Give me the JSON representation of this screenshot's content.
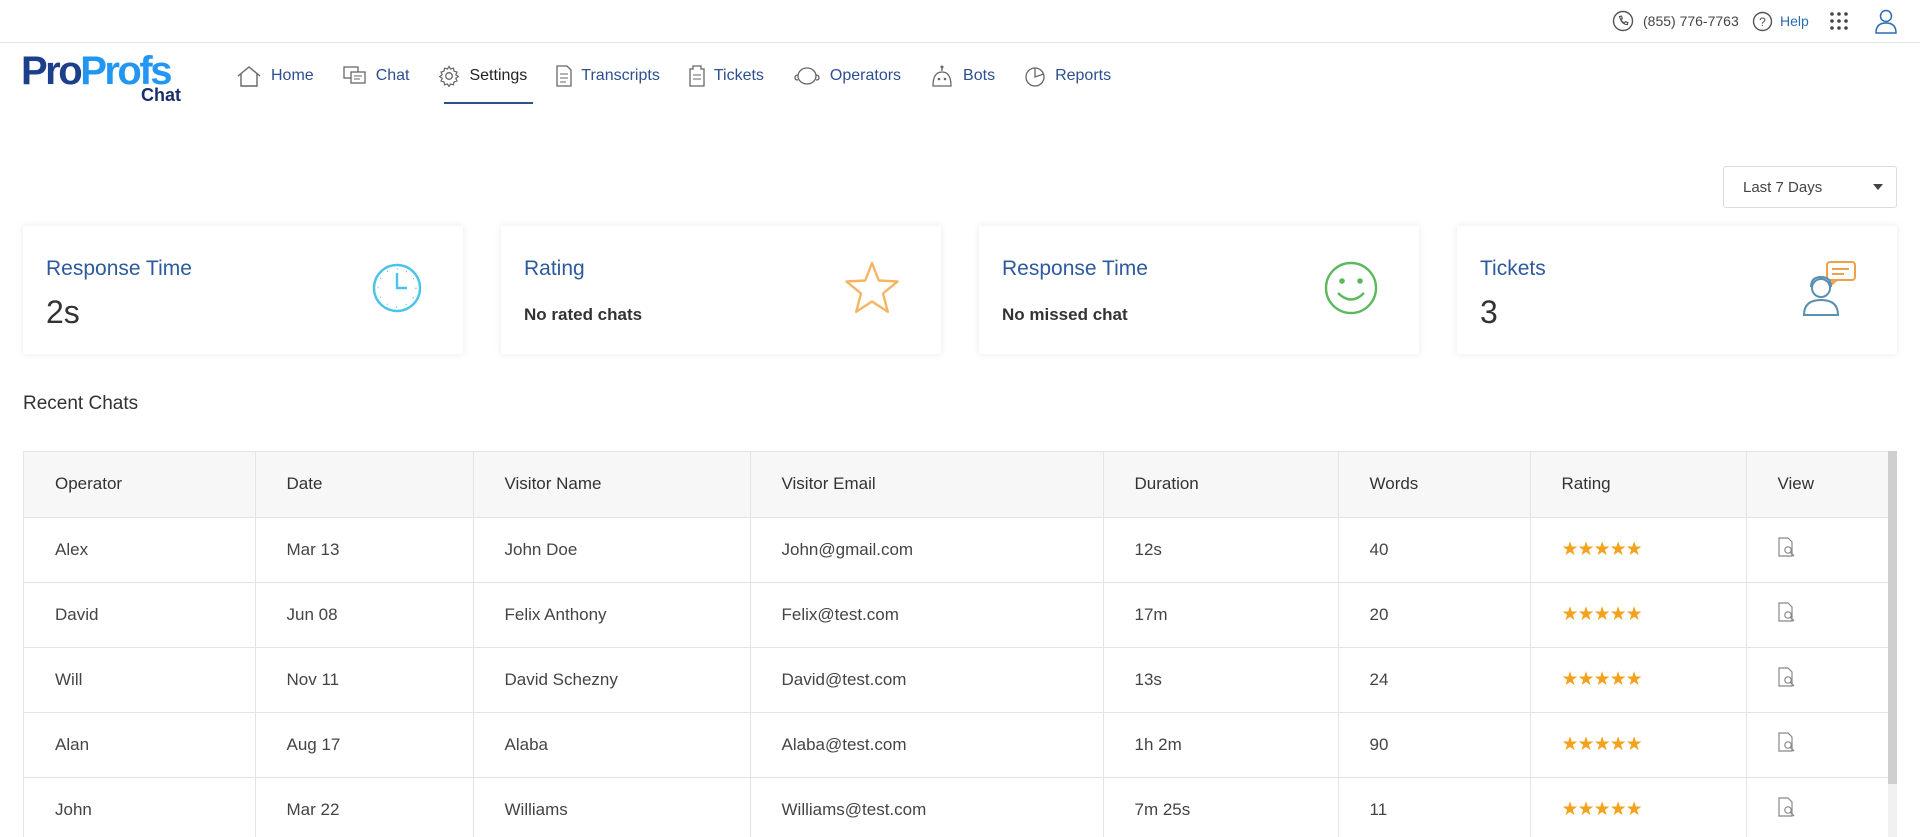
{
  "topbar": {
    "phone": "(855) 776-7763",
    "help": "Help",
    "icons": {
      "phone": "phone-icon",
      "help": "help-circle-icon",
      "apps": "apps-grid-icon",
      "user": "user-icon"
    }
  },
  "logo": {
    "pro": "Pro",
    "profs": "Profs",
    "product": "Chat"
  },
  "nav": [
    {
      "label": "Home",
      "icon": "home-icon"
    },
    {
      "label": "Chat",
      "icon": "chat-icon"
    },
    {
      "label": "Settings",
      "icon": "gear-icon",
      "active": true
    },
    {
      "label": "Transcripts",
      "icon": "document-icon"
    },
    {
      "label": "Tickets",
      "icon": "ticket-icon"
    },
    {
      "label": "Operators",
      "icon": "operators-icon"
    },
    {
      "label": "Bots",
      "icon": "bot-icon"
    },
    {
      "label": "Reports",
      "icon": "pie-chart-icon"
    }
  ],
  "filter": {
    "selected": "Last 7 Days"
  },
  "cards": [
    {
      "title": "Response Time",
      "value": "2s",
      "icon": "clock-icon"
    },
    {
      "title": "Rating",
      "subtitle": "No rated chats",
      "icon": "star-icon"
    },
    {
      "title": "Response Time",
      "subtitle": "No missed chat",
      "icon": "smiley-icon"
    },
    {
      "title": "Tickets",
      "value": "3",
      "icon": "support-agent-icon"
    }
  ],
  "recent": {
    "title": "Recent Chats",
    "columns": [
      "Operator",
      "Date",
      "Visitor Name",
      "Visitor Email",
      "Duration",
      "Words",
      "Rating",
      "View"
    ],
    "rows": [
      {
        "operator": "Alex",
        "date": "Mar 13",
        "visitor": "John Doe",
        "email": "John@gmail.com",
        "duration": "12s",
        "words": "40",
        "rating": 5
      },
      {
        "operator": "David",
        "date": "Jun 08",
        "visitor": "Felix Anthony",
        "email": "Felix@test.com",
        "duration": "17m",
        "words": "20",
        "rating": 5
      },
      {
        "operator": "Will",
        "date": "Nov 11",
        "visitor": "David Schezny",
        "email": "David@test.com",
        "duration": "13s",
        "words": "24",
        "rating": 5
      },
      {
        "operator": "Alan",
        "date": "Aug 17",
        "visitor": "Alaba",
        "email": "Alaba@test.com",
        "duration": "1h 2m",
        "words": "90",
        "rating": 5
      },
      {
        "operator": "John",
        "date": "Mar 22",
        "visitor": "Williams",
        "email": "Williams@test.com",
        "duration": "7m 25s",
        "words": "11",
        "rating": 5
      }
    ]
  },
  "colors": {
    "accent": "#2d4f8f",
    "star": "#f4a21c",
    "clock": "#4cc3e8",
    "starIcon": "#f3b562",
    "smiley": "#5cb85c",
    "ticket": "#f0a04b"
  }
}
